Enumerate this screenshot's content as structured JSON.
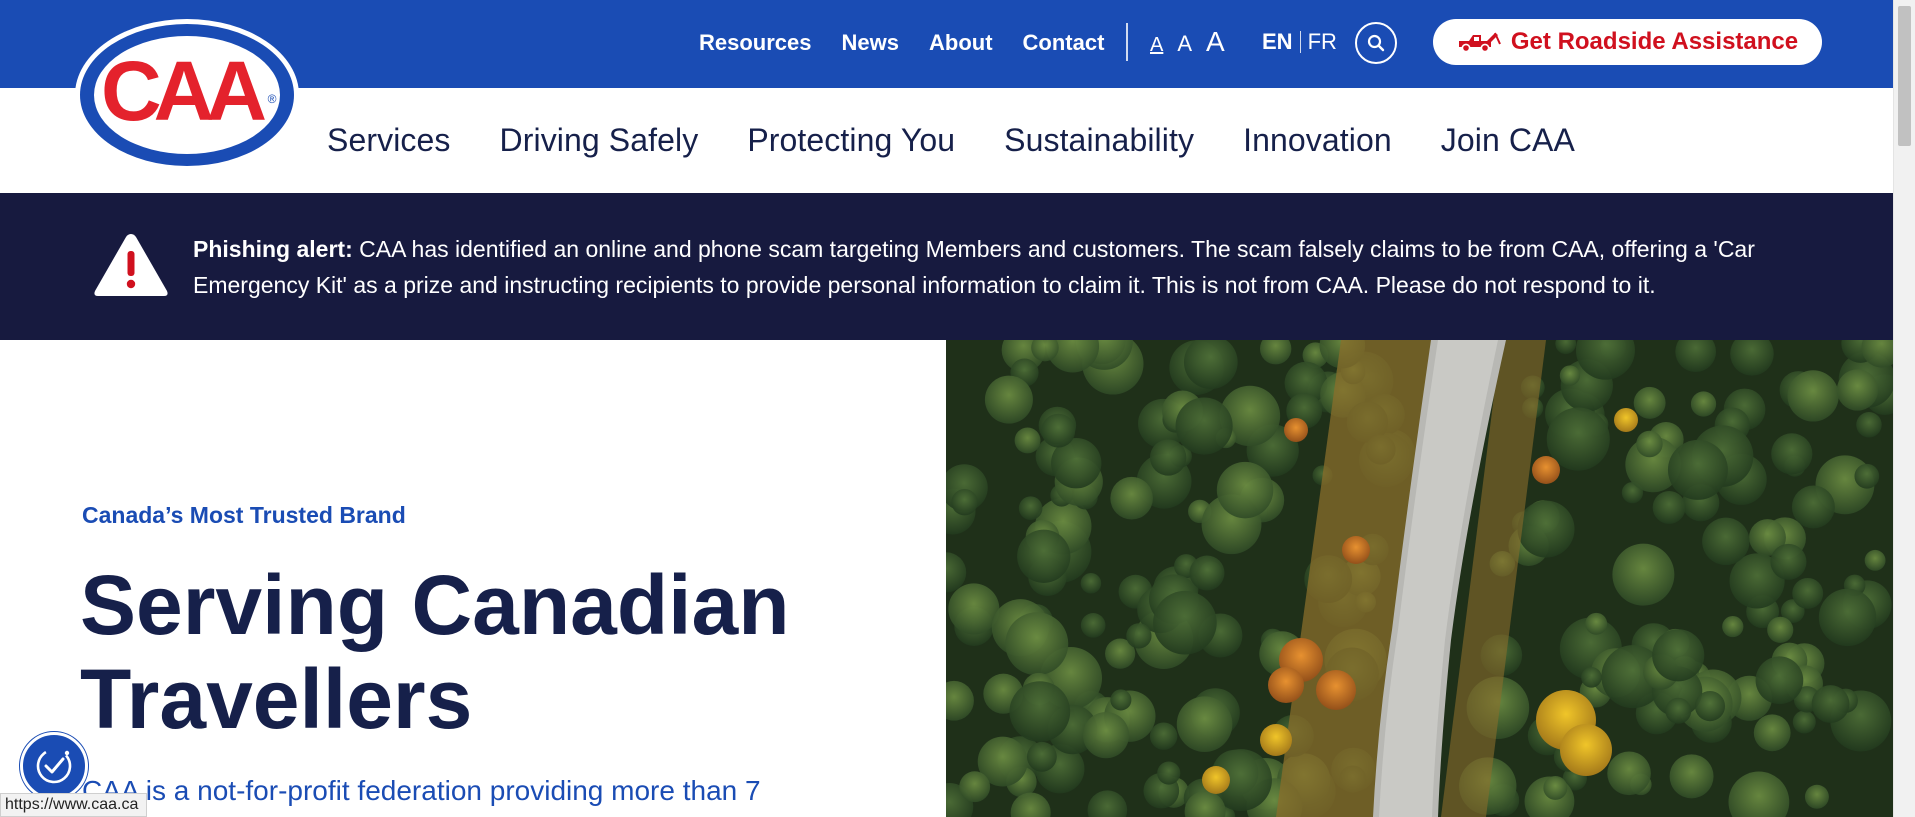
{
  "logo": {
    "text": "CAA",
    "reg_mark": "®"
  },
  "topnav": {
    "links": [
      "Resources",
      "News",
      "About",
      "Contact"
    ],
    "font_sizes": [
      "A",
      "A",
      "A"
    ],
    "lang_en": "EN",
    "lang_fr": "FR",
    "search_icon": "search-icon",
    "roadside_label": "Get Roadside Assistance",
    "roadside_icon": "tow-truck-icon"
  },
  "mainnav": {
    "items": [
      "Services",
      "Driving Safely",
      "Protecting You",
      "Sustainability",
      "Innovation",
      "Join CAA"
    ]
  },
  "alert": {
    "icon": "warning-icon",
    "label": "Phishing alert:",
    "message": " CAA has identified an online and phone scam targeting Members and customers. The scam falsely claims to be from CAA, offering a 'Car Emergency Kit' as a prize and instructing recipients to provide personal information to claim it. This is not from CAA. Please do not respond to it."
  },
  "hero": {
    "eyebrow": "Canada’s Most Trusted Brand",
    "title": "Serving Canadian Travellers",
    "description": "CAA is a not-for-profit federation providing more than 7",
    "image": "aerial-forest-road-image"
  },
  "accessibility": {
    "icon": "accessibility-icon"
  },
  "status": {
    "url": "https://www.caa.ca"
  },
  "colors": {
    "brand_blue": "#1a4cb4",
    "navy": "#171a3f",
    "text_navy": "#16204a",
    "roadside_red": "#d0101e",
    "logo_red": "#e4222c"
  }
}
